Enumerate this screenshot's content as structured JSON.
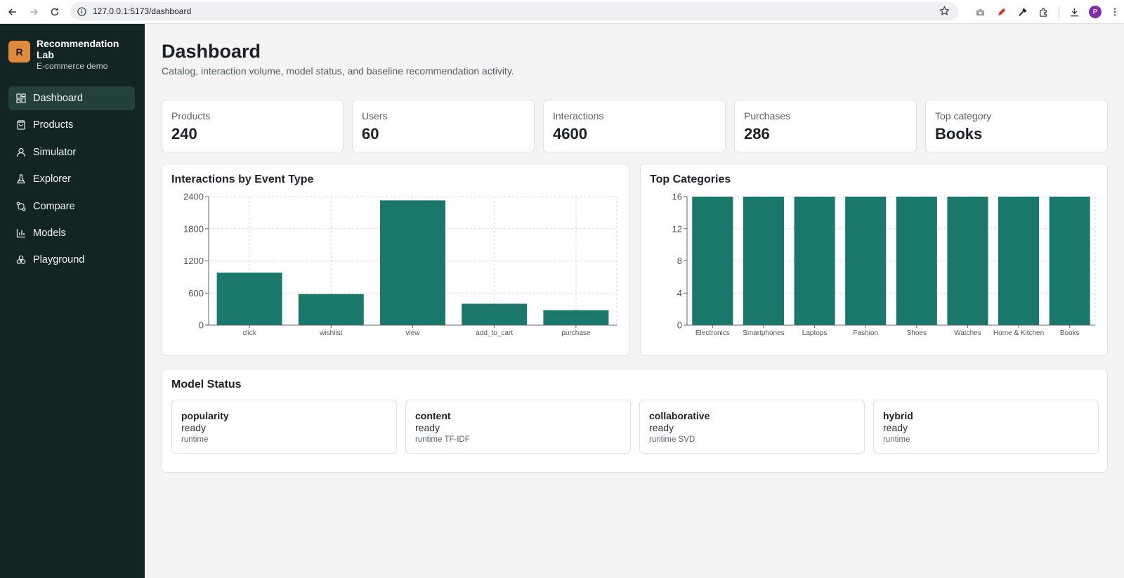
{
  "browser": {
    "url": "127.0.0.1:5173/dashboard",
    "profile_initial": "P"
  },
  "sidebar": {
    "logo_letter": "R",
    "title": "Recommendation Lab",
    "subtitle": "E-commerce demo",
    "items": [
      {
        "label": "Dashboard",
        "icon": "dashboard-icon",
        "active": true
      },
      {
        "label": "Products",
        "icon": "shopping-bag-icon",
        "active": false
      },
      {
        "label": "Simulator",
        "icon": "user-icon",
        "active": false
      },
      {
        "label": "Explorer",
        "icon": "flask-icon",
        "active": false
      },
      {
        "label": "Compare",
        "icon": "git-compare-icon",
        "active": false
      },
      {
        "label": "Models",
        "icon": "bar-chart-icon",
        "active": false
      },
      {
        "label": "Playground",
        "icon": "puzzle-icon",
        "active": false
      }
    ]
  },
  "header": {
    "title": "Dashboard",
    "subtitle": "Catalog, interaction volume, model status, and baseline recommendation activity."
  },
  "stats": [
    {
      "label": "Products",
      "value": "240"
    },
    {
      "label": "Users",
      "value": "60"
    },
    {
      "label": "Interactions",
      "value": "4600"
    },
    {
      "label": "Purchases",
      "value": "286"
    },
    {
      "label": "Top category",
      "value": "Books"
    }
  ],
  "colors": {
    "bar": "#19786a",
    "sidebar_bg": "#132522",
    "accent_logo": "#e08a3b"
  },
  "chart_data": [
    {
      "type": "bar",
      "title": "Interactions by Event Type",
      "categories": [
        "click",
        "wishlist",
        "view",
        "add_to_cart",
        "purchase"
      ],
      "values": [
        980,
        580,
        2330,
        400,
        280
      ],
      "ylim": [
        0,
        2400
      ],
      "yticks": [
        0,
        600,
        1200,
        1800,
        2400
      ],
      "grid": true
    },
    {
      "type": "bar",
      "title": "Top Categories",
      "categories": [
        "Electronics",
        "Smartphones",
        "Laptops",
        "Fashion",
        "Shoes",
        "Watches",
        "Home & Kitchen",
        "Books"
      ],
      "values": [
        16,
        16,
        16,
        16,
        16,
        16,
        16,
        16
      ],
      "ylim": [
        0,
        16
      ],
      "yticks": [
        0,
        4,
        8,
        12,
        16
      ],
      "grid": true
    }
  ],
  "model_status": {
    "title": "Model Status",
    "models": [
      {
        "name": "popularity",
        "status": "ready",
        "runtime": "runtime"
      },
      {
        "name": "content",
        "status": "ready",
        "runtime": "runtime TF-IDF"
      },
      {
        "name": "collaborative",
        "status": "ready",
        "runtime": "runtime SVD"
      },
      {
        "name": "hybrid",
        "status": "ready",
        "runtime": "runtime"
      }
    ]
  }
}
